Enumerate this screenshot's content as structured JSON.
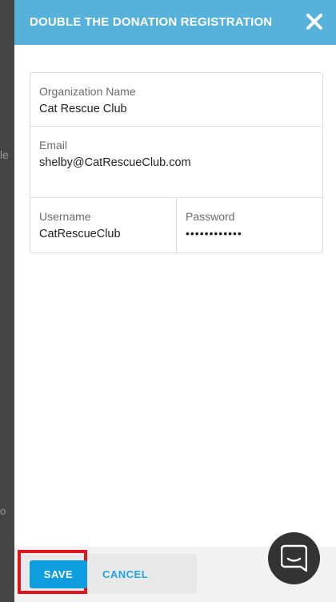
{
  "background": {
    "partial_text_top": "le",
    "partial_text_bottom": "o"
  },
  "header": {
    "title": "DOUBLE THE DONATION REGISTRATION",
    "close_icon": "close-icon",
    "background_color": "#56b2da"
  },
  "form": {
    "organization": {
      "label": "Organization Name",
      "value": "Cat Rescue Club"
    },
    "email": {
      "label": "Email",
      "value": "shelby@CatRescueClub.com"
    },
    "username": {
      "label": "Username",
      "value": "CatRescueClub"
    },
    "password": {
      "label": "Password",
      "value": "••••••••••••"
    }
  },
  "footer": {
    "save_label": "SAVE",
    "cancel_label": "CANCEL",
    "save_color": "#0e9ee0",
    "cancel_color": "#23a3dc",
    "highlight_color": "#e0141c"
  },
  "chat": {
    "icon": "chat-bubble-icon"
  }
}
